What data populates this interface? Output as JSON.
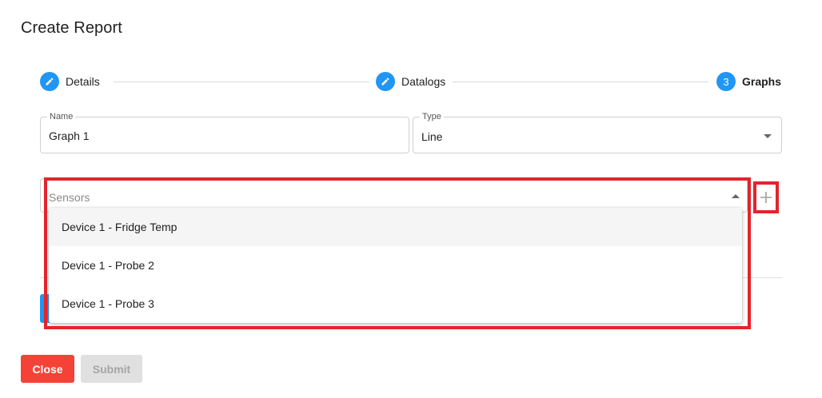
{
  "dialog": {
    "title": "Create Report"
  },
  "stepper": {
    "steps": [
      {
        "label": "Details",
        "icon": "pencil-icon",
        "state": "completed"
      },
      {
        "label": "Datalogs",
        "icon": "pencil-icon",
        "state": "completed"
      },
      {
        "label": "Graphs",
        "number": "3",
        "state": "active"
      }
    ]
  },
  "form": {
    "name_legend": "Name",
    "name_value": "Graph 1",
    "type_legend": "Type",
    "type_value": "Line",
    "sensors_placeholder": "Sensors",
    "sensor_options": [
      {
        "label": "Device 1 - Fridge Temp"
      },
      {
        "label": "Device 1 - Probe 2"
      },
      {
        "label": "Device 1 - Probe 3"
      }
    ]
  },
  "buttons": {
    "close_label": "Close",
    "submit_label": "Submit"
  },
  "colors": {
    "primary": "#2196f3",
    "danger": "#f44336",
    "highlight": "#e3242b",
    "disabled_bg": "#e0e0e0"
  }
}
